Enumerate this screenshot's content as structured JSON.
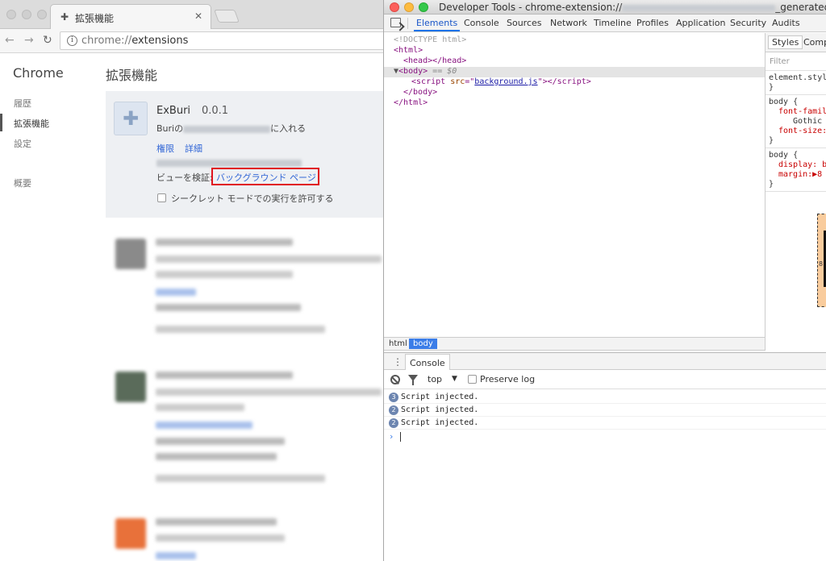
{
  "chrome_window": {
    "tab": {
      "title": "拡張機能",
      "icon": "puzzle-icon",
      "close": "✕"
    },
    "toolbar": {
      "url_scheme": "chrome://",
      "url_path": "extensions"
    },
    "sidebar": {
      "title": "Chrome",
      "items": [
        {
          "label": "履歴"
        },
        {
          "label": "拡張機能",
          "active": true
        },
        {
          "label": "設定"
        },
        {
          "label": "概要"
        }
      ]
    },
    "page": {
      "title": "拡張機能",
      "extension": {
        "name": "ExBuri",
        "version": "0.0.1",
        "description_prefix": "Buriの",
        "description_suffix": "に入れる",
        "link_permissions": "権限",
        "link_details": "詳細",
        "inspect_views_label": "ビューを検証:",
        "background_page_link": "バックグラウンド ページ",
        "incognito_label": "シークレット モードでの実行を許可する",
        "highlight_color": "#e0141e"
      }
    }
  },
  "devtools": {
    "title_prefix": "Developer Tools - chrome-extension://",
    "title_suffix": "_generated_ba",
    "tabs": [
      {
        "label": "Elements",
        "active": true
      },
      {
        "label": "Console"
      },
      {
        "label": "Sources"
      },
      {
        "label": "Network"
      },
      {
        "label": "Timeline"
      },
      {
        "label": "Profiles"
      },
      {
        "label": "Application"
      },
      {
        "label": "Security"
      },
      {
        "label": "Audits"
      }
    ],
    "dom_tree": {
      "doctype": "<!DOCTYPE html>",
      "html_open": "<html>",
      "head": "<head></head>",
      "body_open": "<body>",
      "body_eq": " == ",
      "body_var": "$0",
      "script_tag": "script",
      "script_attr": "src",
      "script_src": "background.js",
      "body_close": "</body>",
      "html_close": "</html>"
    },
    "breadcrumbs": [
      {
        "label": "html"
      },
      {
        "label": "body",
        "active": true
      }
    ],
    "styles_panel": {
      "tabs": [
        {
          "label": "Styles",
          "active": true
        },
        {
          "label": "Comp"
        }
      ],
      "filter_placeholder": "Filter",
      "element_style": "element.style",
      "rules": [
        {
          "selector": "body {",
          "props": [
            "font-famil",
            "Gothic",
            "font-size:"
          ]
        },
        {
          "selector": "body {",
          "props": [
            "display: b",
            "margin:▶8"
          ]
        }
      ],
      "box_model_value": "8"
    },
    "drawer": {
      "tab_label": "Console",
      "context": "top",
      "preserve_log_label": "Preserve log",
      "messages": [
        {
          "count": "3",
          "text": "Script injected."
        },
        {
          "count": "2",
          "text": "Script injected."
        },
        {
          "count": "2",
          "text": "Script injected."
        }
      ],
      "prompt": "›"
    }
  }
}
